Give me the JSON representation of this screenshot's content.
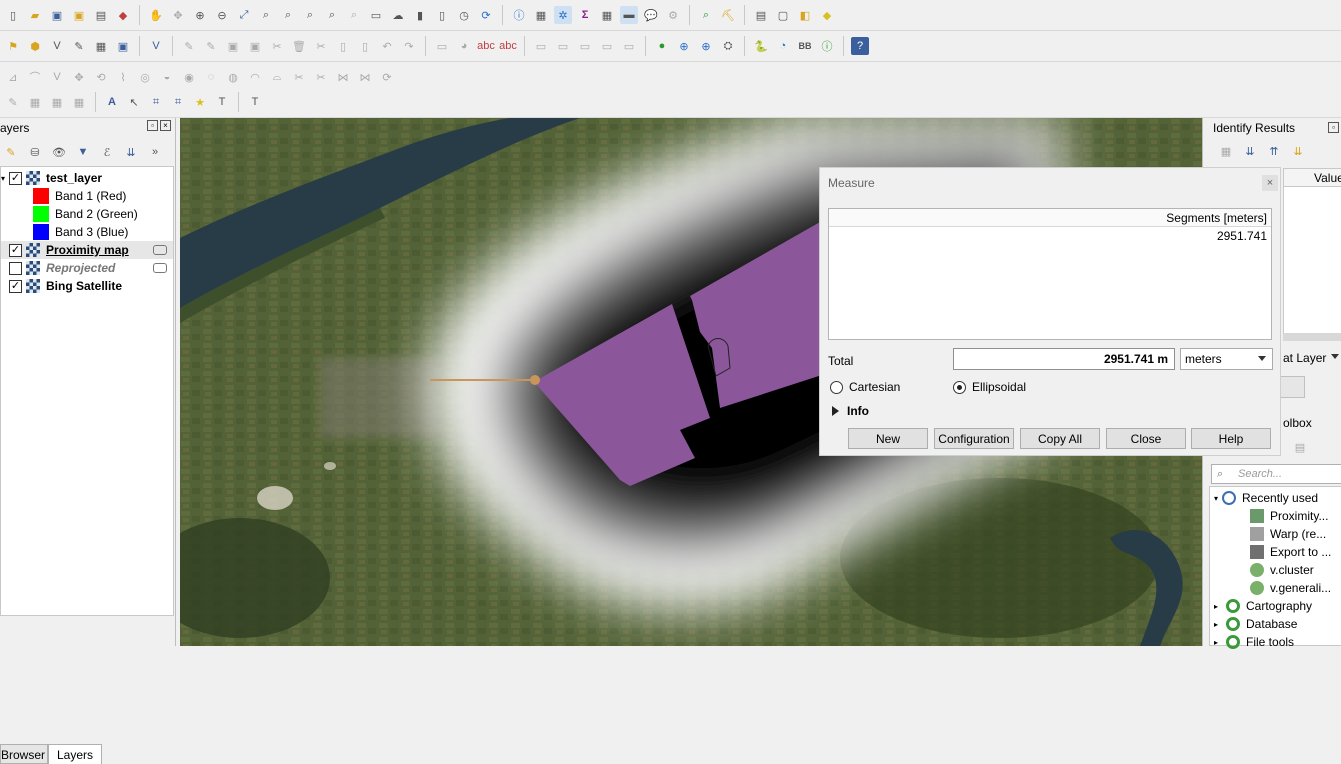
{
  "layers_panel": {
    "title": "ayers",
    "items": [
      {
        "label": "test_layer",
        "checked": true,
        "style": "bold"
      },
      {
        "label": "Band 1 (Red)",
        "color": "#ff0000"
      },
      {
        "label": "Band 2 (Green)",
        "color": "#00ff00"
      },
      {
        "label": "Band 3 (Blue)",
        "color": "#0000ff"
      },
      {
        "label": "Proximity map",
        "checked": true,
        "style": "bold-underline"
      },
      {
        "label": "Reprojected",
        "checked": false,
        "style": "italic"
      },
      {
        "label": "Bing Satellite",
        "checked": true,
        "style": "bold"
      }
    ],
    "tabs": [
      "Browser",
      "Layers"
    ],
    "active_tab": "Layers"
  },
  "identify_panel": {
    "title": "Identify Results",
    "value_header": "Value",
    "layer_label": "at Layer",
    "toolbox_label": "olbox",
    "search_placeholder": "Search...",
    "tree": [
      {
        "label": "Recently used",
        "level": 0,
        "expanded": true
      },
      {
        "label": "Proximity...",
        "level": 1
      },
      {
        "label": "Warp (re...",
        "level": 1
      },
      {
        "label": "Export to ...",
        "level": 1
      },
      {
        "label": "v.cluster",
        "level": 1
      },
      {
        "label": "v.generali...",
        "level": 1
      },
      {
        "label": "Cartography",
        "level": 0
      },
      {
        "label": "Database",
        "level": 0
      },
      {
        "label": "File tools",
        "level": 0
      }
    ]
  },
  "measure_dialog": {
    "title": "Measure",
    "segments_header": "Segments [meters]",
    "segments": [
      "2951.741"
    ],
    "total_label": "Total",
    "total_value": "2951.741 m",
    "unit": "meters",
    "radio_cartesian": "Cartesian",
    "radio_ellipsoidal": "Ellipsoidal",
    "selected_mode": "Ellipsoidal",
    "info_label": "Info",
    "buttons": {
      "new": "New",
      "configuration": "Configuration",
      "copy_all": "Copy All",
      "close": "Close",
      "help": "Help"
    }
  },
  "toolbar": {
    "sigma": "Σ",
    "bb_label": "BB"
  },
  "colors": {
    "polygon": "#8b579a",
    "measure_line": "#c8965a",
    "satellite_green": "#4d5a32"
  }
}
